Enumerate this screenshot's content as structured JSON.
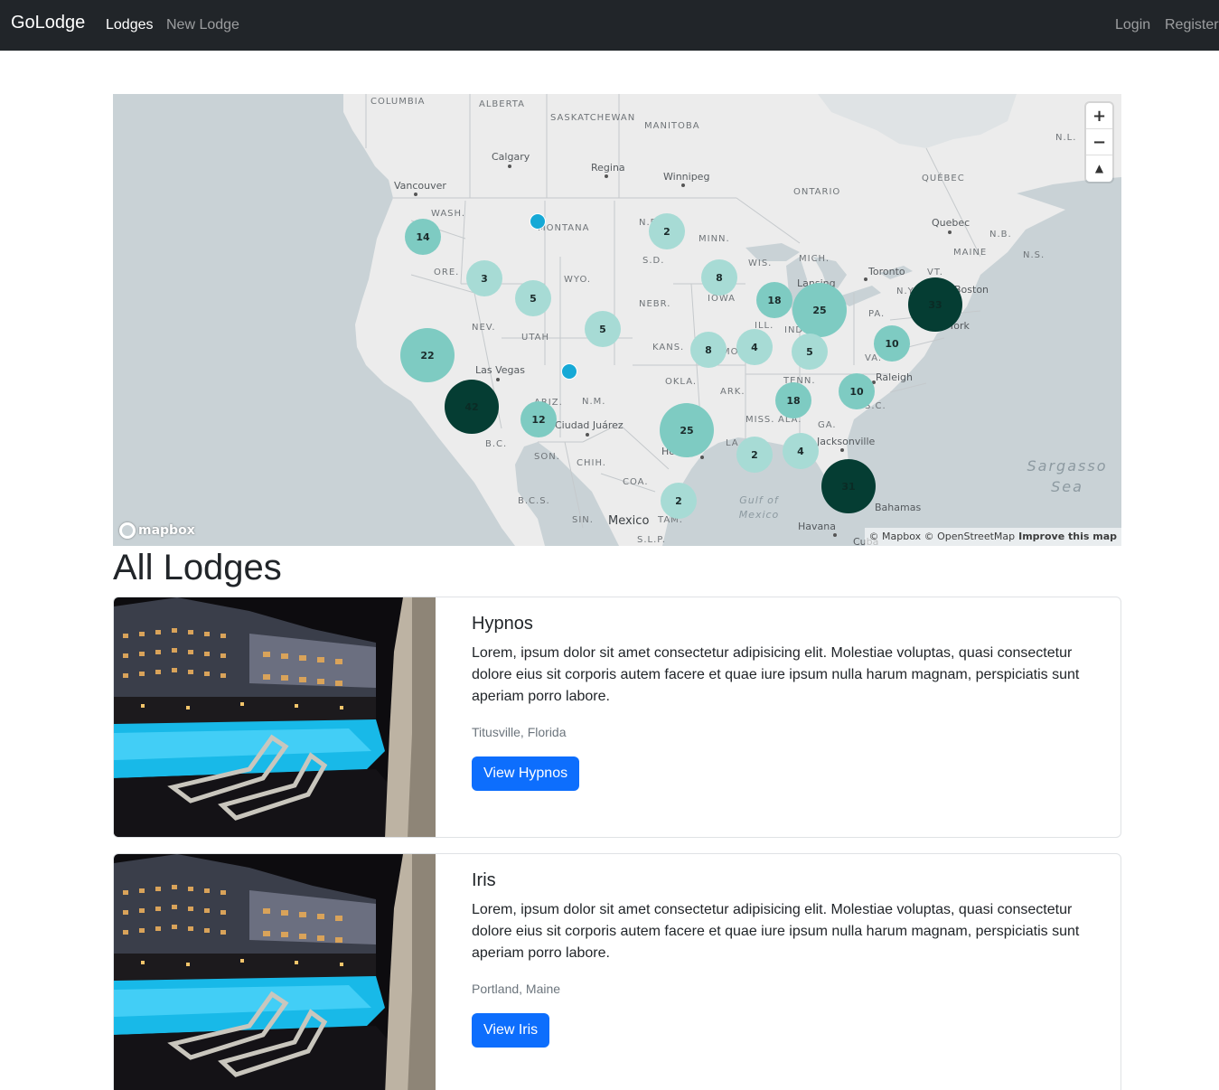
{
  "navbar": {
    "brand": "GoLodge",
    "links": [
      {
        "label": "Lodges"
      },
      {
        "label": "New Lodge"
      }
    ],
    "auth": [
      {
        "label": "Login"
      },
      {
        "label": "Register"
      }
    ]
  },
  "map": {
    "controls": {
      "zoom_in": "+",
      "zoom_out": "−",
      "compass": "▲"
    },
    "logo": "mapbox",
    "attribution": {
      "text": "© Mapbox © OpenStreetMap",
      "improve": "Improve this map"
    },
    "region_labels": [
      "COLUMBIA",
      "ALBERTA",
      "SASKATCHEWAN",
      "MANITOBA",
      "ONTARIO",
      "QUÉBEC",
      "N.L.",
      "WASH.",
      "MONTANA",
      "N.D.",
      "MINN.",
      "ORE.",
      "WYO.",
      "S.D.",
      "WIS.",
      "MICH.",
      "N.Y.",
      "VT.",
      "MAINE",
      "N.B.",
      "N.S.",
      "NEV.",
      "UTAH",
      "NEBR.",
      "IOWA",
      "ILL.",
      "IND.",
      "PA.",
      "KANS.",
      "MO.",
      "VA.",
      "OKLA.",
      "ARK.",
      "TENN.",
      "N.M.",
      "ARIZ.",
      "MISS.",
      "ALA.",
      "GA.",
      "LA.",
      "S.C.",
      "B.C.",
      "SON.",
      "CHIH.",
      "COA.",
      "B.C.S.",
      "SIN.",
      "TAM.",
      "S.L.P."
    ],
    "city_labels": [
      "Calgary",
      "Regina",
      "Winnipeg",
      "Vancouver",
      "Quebec",
      "Toronto",
      "Boston",
      "Lansing",
      "York",
      "Las Vegas",
      "Raleigh",
      "Ciudad Juárez",
      "Jacksonville",
      "Ho",
      "Bahamas",
      "Havana",
      "Cuba"
    ],
    "big_labels": [
      "Mexico"
    ],
    "water_labels": {
      "sargasso": "Sargasso\nSea",
      "gulf": "Gulf of\nMexico"
    },
    "clusters": [
      "14",
      "3",
      "5",
      "5",
      "22",
      "42",
      "12",
      "2",
      "8",
      "18",
      "25",
      "33",
      "4",
      "8",
      "5",
      "10",
      "10",
      "18",
      "25",
      "2",
      "4",
      "31",
      "2"
    ]
  },
  "page_title": "All Lodges",
  "lodges": [
    {
      "title": "Hypnos",
      "description": "Lorem, ipsum dolor sit amet consectetur adipisicing elit. Molestiae voluptas, quasi consectetur dolore eius sit corporis autem facere et quae iure ipsum nulla harum magnam, perspiciatis sunt aperiam porro labore.",
      "location": "Titusville, Florida",
      "button": "View Hypnos"
    },
    {
      "title": "Iris",
      "description": "Lorem, ipsum dolor sit amet consectetur adipisicing elit. Molestiae voluptas, quasi consectetur dolore eius sit corporis autem facere et quae iure ipsum nulla harum magnam, perspiciatis sunt aperiam porro labore.",
      "location": "Portland, Maine",
      "button": "View Iris"
    }
  ],
  "colors": {
    "navbar": "#212529",
    "primary": "#0d6efd",
    "cluster_small": "#a7dbd5",
    "cluster_medium": "#7ecbc2",
    "cluster_large": "#053d33",
    "point": "#16a9d6"
  }
}
